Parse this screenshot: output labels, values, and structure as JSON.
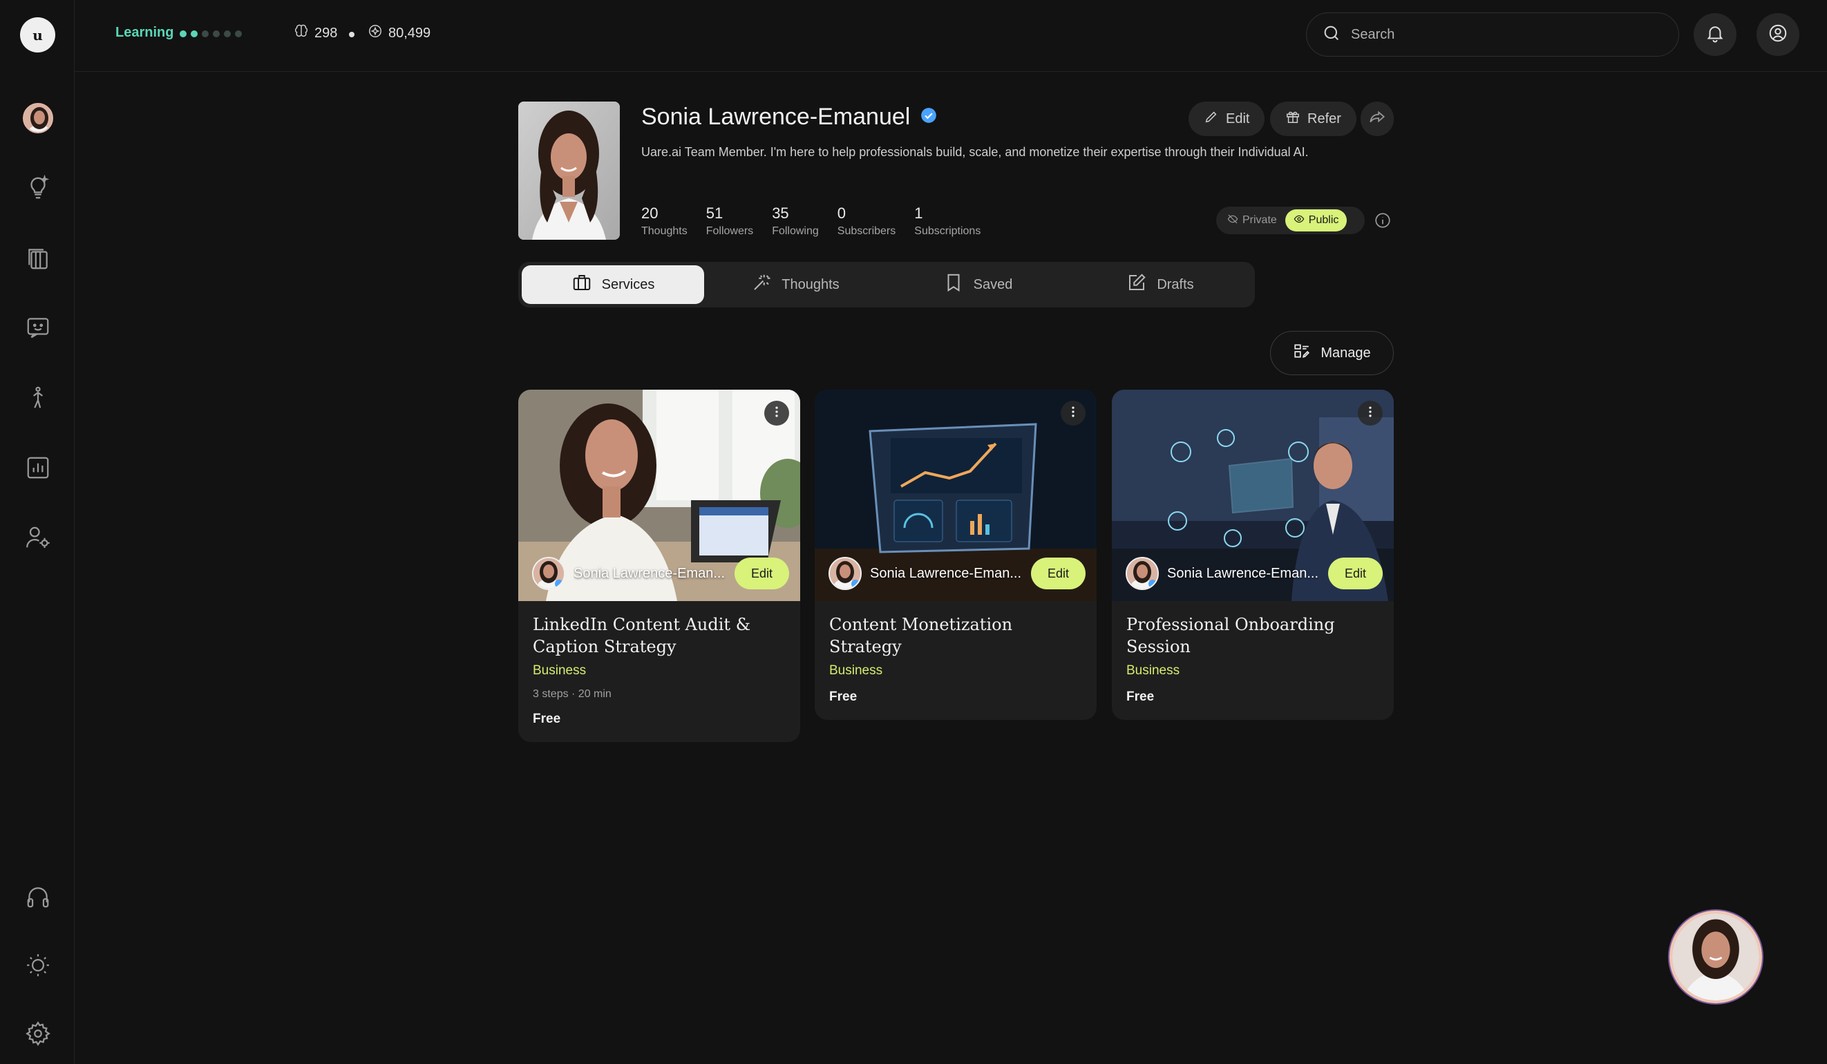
{
  "topbar": {
    "learning_label": "Learning",
    "learning_progress": {
      "filled": 2,
      "total": 6
    },
    "tokens": "298",
    "points": "80,499",
    "search_placeholder": "Search"
  },
  "sidebar": {
    "logo_text": "u",
    "items": [
      {
        "icon": "avatar"
      },
      {
        "icon": "lightbulb-icon"
      },
      {
        "icon": "library-icon"
      },
      {
        "icon": "chat-smile-icon"
      },
      {
        "icon": "person-walking-icon"
      },
      {
        "icon": "analytics-icon"
      },
      {
        "icon": "user-settings-icon"
      }
    ],
    "bottom": [
      {
        "icon": "headphones-icon"
      },
      {
        "icon": "sun-icon"
      },
      {
        "icon": "gear-icon"
      }
    ]
  },
  "profile": {
    "name": "Sonia Lawrence-Emanuel",
    "bio": "Uare.ai Team Member. I'm here to help professionals build, scale, and monetize their expertise through their Individual AI.",
    "stats": [
      {
        "value": "20",
        "label": "Thoughts"
      },
      {
        "value": "51",
        "label": "Followers"
      },
      {
        "value": "35",
        "label": "Following"
      },
      {
        "value": "0",
        "label": "Subscribers"
      },
      {
        "value": "1",
        "label": "Subscriptions"
      }
    ],
    "edit_label": "Edit",
    "refer_label": "Refer",
    "visibility": {
      "private_label": "Private",
      "public_label": "Public",
      "selected": "Public"
    }
  },
  "tabs": [
    {
      "label": "Services",
      "icon": "briefcase-icon",
      "active": true
    },
    {
      "label": "Thoughts",
      "icon": "sparkle-wand-icon",
      "active": false
    },
    {
      "label": "Saved",
      "icon": "bookmark-icon",
      "active": false
    },
    {
      "label": "Drafts",
      "icon": "edit-square-icon",
      "active": false
    }
  ],
  "manage_label": "Manage",
  "cards": [
    {
      "owner": "Sonia Lawrence-Eman...",
      "edit_label": "Edit",
      "title": "LinkedIn Content Audit & Caption Strategy",
      "category": "Business",
      "meta": "3 steps · 20 min",
      "price": "Free"
    },
    {
      "owner": "Sonia Lawrence-Eman...",
      "edit_label": "Edit",
      "title": "Content Monetization Strategy",
      "category": "Business",
      "meta": "",
      "price": "Free"
    },
    {
      "owner": "Sonia Lawrence-Eman...",
      "edit_label": "Edit",
      "title": "Professional Onboarding Session",
      "category": "Business",
      "meta": "",
      "price": "Free"
    }
  ],
  "colors": {
    "accent_lime": "#d8f27a",
    "accent_teal": "#5bd6b6",
    "verified_blue": "#4aa3ff"
  }
}
